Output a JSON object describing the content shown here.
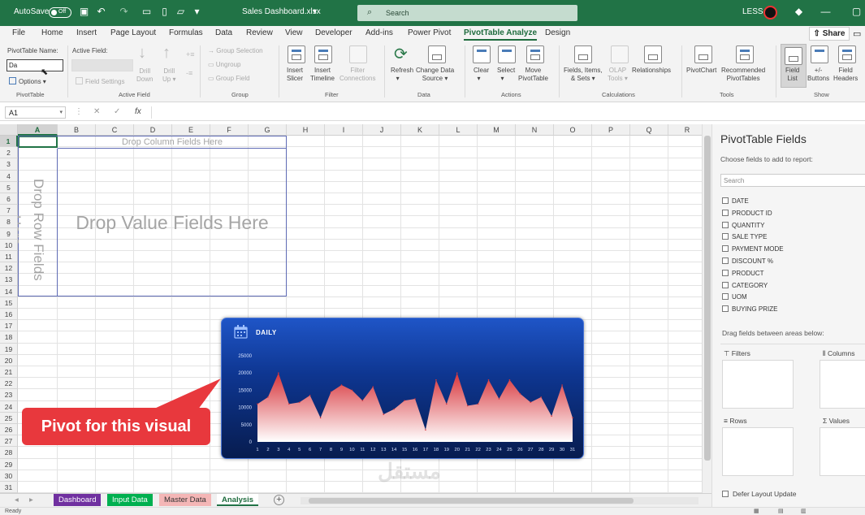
{
  "titlebar": {
    "autosave": "AutoSave",
    "toggle_state": "Off",
    "filename": "Sales Dashboard.xlsx",
    "search_placeholder": "Search",
    "user": "LESS"
  },
  "menu": {
    "tabs": [
      "File",
      "Home",
      "Insert",
      "Page Layout",
      "Formulas",
      "Data",
      "Review",
      "View",
      "Developer",
      "Add-ins",
      "Power Pivot",
      "PivotTable Analyze",
      "Design"
    ],
    "active": "PivotTable Analyze",
    "share": "Share"
  },
  "ribbon": {
    "pivottable_name_label": "PivotTable Name:",
    "pivottable_name_value": "Da",
    "options": "Options",
    "active_field_label": "Active Field:",
    "field_settings": "Field Settings",
    "drill_down": [
      "Drill",
      "Down"
    ],
    "drill_up": [
      "Drill",
      "Up"
    ],
    "group_selection": "Group Selection",
    "ungroup": "Ungroup",
    "group_field": "Group Field",
    "insert_slicer": [
      "Insert",
      "Slicer"
    ],
    "insert_timeline": [
      "Insert",
      "Timeline"
    ],
    "filter_connections": [
      "Filter",
      "Connections"
    ],
    "refresh": "Refresh",
    "change_data_source": [
      "Change Data",
      "Source"
    ],
    "clear": "Clear",
    "select": "Select",
    "move_pivottable": [
      "Move",
      "PivotTable"
    ],
    "fields_items_sets": [
      "Fields, Items,",
      "& Sets"
    ],
    "olap_tools": [
      "OLAP",
      "Tools"
    ],
    "relationships": "Relationships",
    "pivotchart": "PivotChart",
    "recommended_pivottables": [
      "Recommended",
      "PivotTables"
    ],
    "field_list": [
      "Field",
      "List"
    ],
    "buttons": [
      "+/-",
      "Buttons"
    ],
    "field_headers": [
      "Field",
      "Headers"
    ],
    "groups": {
      "pivottable": "PivotTable",
      "active_field": "Active Field",
      "group": "Group",
      "filter": "Filter",
      "data": "Data",
      "actions": "Actions",
      "calculations": "Calculations",
      "tools": "Tools",
      "show": "Show"
    }
  },
  "formulabar": {
    "namebox": "A1",
    "fx": "fx"
  },
  "grid": {
    "columns": [
      "A",
      "B",
      "C",
      "D",
      "E",
      "F",
      "G",
      "H",
      "I",
      "J",
      "K",
      "L",
      "M",
      "N",
      "O",
      "P",
      "Q",
      "R"
    ],
    "rows": [
      "1",
      "2",
      "3",
      "4",
      "5",
      "6",
      "7",
      "8",
      "9",
      "10",
      "11",
      "12",
      "13",
      "14",
      "15",
      "16",
      "17",
      "18",
      "19",
      "20",
      "21",
      "22",
      "23",
      "24",
      "25",
      "26",
      "27",
      "28",
      "29",
      "30",
      "31"
    ],
    "drop_column": "Drop Column Fields Here",
    "drop_row": "Drop Row Fields Here",
    "drop_value": "Drop Value Fields Here"
  },
  "chart_data": {
    "type": "area",
    "title": "DAILY",
    "x": [
      1,
      2,
      3,
      4,
      5,
      6,
      7,
      8,
      9,
      10,
      11,
      12,
      13,
      14,
      15,
      16,
      17,
      18,
      19,
      20,
      21,
      22,
      23,
      24,
      25,
      26,
      27,
      28,
      29,
      30,
      31
    ],
    "values": [
      11000,
      13000,
      20000,
      11000,
      11500,
      13500,
      7000,
      14500,
      16500,
      15000,
      12000,
      16000,
      8000,
      9500,
      12000,
      12500,
      3500,
      18000,
      11000,
      20000,
      10500,
      11000,
      18000,
      12500,
      18000,
      14000,
      11500,
      13000,
      7500,
      16500,
      7000
    ],
    "ylim": [
      0,
      25000
    ],
    "yticks": [
      0,
      5000,
      10000,
      15000,
      20000,
      25000
    ],
    "colors": {
      "fill_top": "#d7343a",
      "fill_bottom": "#ffffff",
      "background": "#0d2d7e"
    }
  },
  "callout": {
    "text": "Pivot for this visual",
    "color": "#e8383d"
  },
  "pane": {
    "title": "PivotTable Fields",
    "subtitle": "Choose fields to add to report:",
    "search_placeholder": "Search",
    "fields": [
      "DATE",
      "PRODUCT ID",
      "QUANTITY",
      "SALE TYPE",
      "PAYMENT MODE",
      "DISCOUNT %",
      "PRODUCT",
      "CATEGORY",
      "UOM",
      "BUYING PRIZE"
    ],
    "drag_hint": "Drag fields between areas below:",
    "areas": {
      "filters": "Filters",
      "columns": "Columns",
      "rows": "Rows",
      "values": "Values"
    },
    "defer": "Defer Layout Update"
  },
  "sheets": [
    {
      "name": "Dashboard",
      "color": "#7030a0"
    },
    {
      "name": "Input Data",
      "color": "#00b050"
    },
    {
      "name": "Master Data",
      "color": "#f4b6b6"
    },
    {
      "name": "Analysis",
      "color": "#ffffff"
    }
  ],
  "status": {
    "ready": "Ready"
  }
}
